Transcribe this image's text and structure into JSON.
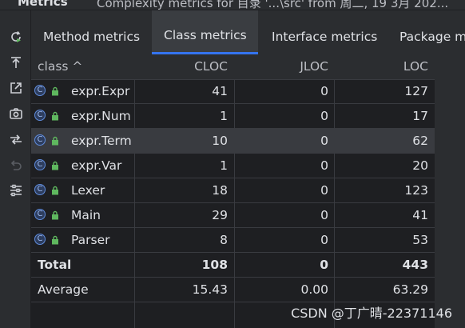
{
  "window": {
    "title": "Metrics",
    "subtitle": "Complexity metrics for 目录 '...\\src' from 周二, 19 3月 202..."
  },
  "toolbar": {
    "icons": [
      "rerun-icon",
      "export-icon",
      "open-external-icon",
      "camera-icon",
      "diff-icon",
      "undo-icon",
      "settings-icon"
    ]
  },
  "tabs": [
    {
      "label": "Method metrics"
    },
    {
      "label": "Class metrics"
    },
    {
      "label": "Interface metrics"
    },
    {
      "label": "Package m"
    }
  ],
  "active_tab": "Class metrics",
  "table": {
    "columns": [
      "class ^",
      "CLOC",
      "JLOC",
      "LOC"
    ],
    "rows": [
      {
        "name": "expr.Expr",
        "cloc": "41",
        "jloc": "0",
        "loc": "127"
      },
      {
        "name": "expr.Num",
        "cloc": "1",
        "jloc": "0",
        "loc": "17"
      },
      {
        "name": "expr.Term",
        "cloc": "10",
        "jloc": "0",
        "loc": "62"
      },
      {
        "name": "expr.Var",
        "cloc": "1",
        "jloc": "0",
        "loc": "20"
      },
      {
        "name": "Lexer",
        "cloc": "18",
        "jloc": "0",
        "loc": "123"
      },
      {
        "name": "Main",
        "cloc": "29",
        "jloc": "0",
        "loc": "41"
      },
      {
        "name": "Parser",
        "cloc": "8",
        "jloc": "0",
        "loc": "53"
      }
    ],
    "total": {
      "name": "Total",
      "cloc": "108",
      "jloc": "0",
      "loc": "443"
    },
    "average": {
      "name": "Average",
      "cloc": "15.43",
      "jloc": "0.00",
      "loc": "63.29"
    },
    "selected_row": "expr.Term",
    "class_icon_glyph": "C"
  },
  "watermark": "CSDN @丁广晴-22371146",
  "colors": {
    "accent": "#3574f0",
    "background": "#1e1f22",
    "panel": "#2b2d30",
    "lock": "#5fb85f",
    "class_icon": "#5f8cdd"
  }
}
